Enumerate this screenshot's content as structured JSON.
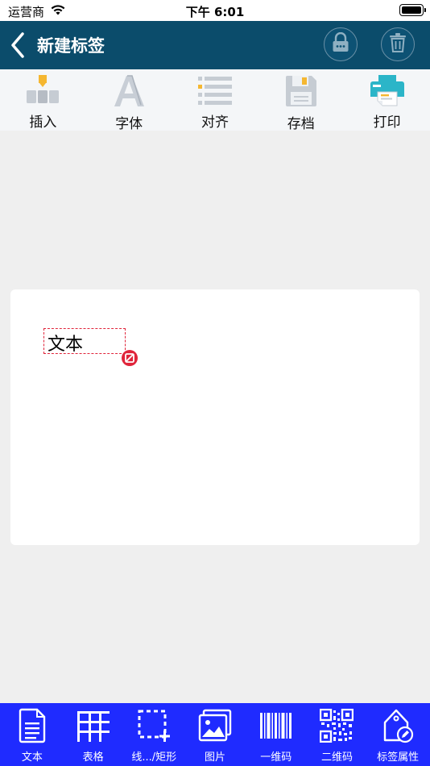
{
  "status_bar": {
    "carrier": "运营商",
    "time": "下午 6:01"
  },
  "nav": {
    "title": "新建标签"
  },
  "toolbar": {
    "items": [
      {
        "label": "插入",
        "icon": "insert-blocks-icon"
      },
      {
        "label": "字体",
        "icon": "font-icon"
      },
      {
        "label": "对齐",
        "icon": "align-list-icon"
      },
      {
        "label": "存档",
        "icon": "save-floppy-icon"
      },
      {
        "label": "打印",
        "icon": "printer-icon"
      }
    ]
  },
  "canvas": {
    "text_element": "文本"
  },
  "bottom_bar": {
    "items": [
      {
        "label": "文本",
        "icon": "document-text-icon"
      },
      {
        "label": "表格",
        "icon": "table-grid-icon"
      },
      {
        "label": "线.../矩形",
        "icon": "dashed-rect-add-icon"
      },
      {
        "label": "图片",
        "icon": "image-icon"
      },
      {
        "label": "一维码",
        "icon": "barcode-icon"
      },
      {
        "label": "二维码",
        "icon": "qrcode-icon"
      },
      {
        "label": "标签属性",
        "icon": "tag-edit-icon"
      }
    ]
  },
  "colors": {
    "nav_bg": "#0b4c6b",
    "bottom_bar_bg": "#1f2bff",
    "accent_red": "#e0243a"
  }
}
